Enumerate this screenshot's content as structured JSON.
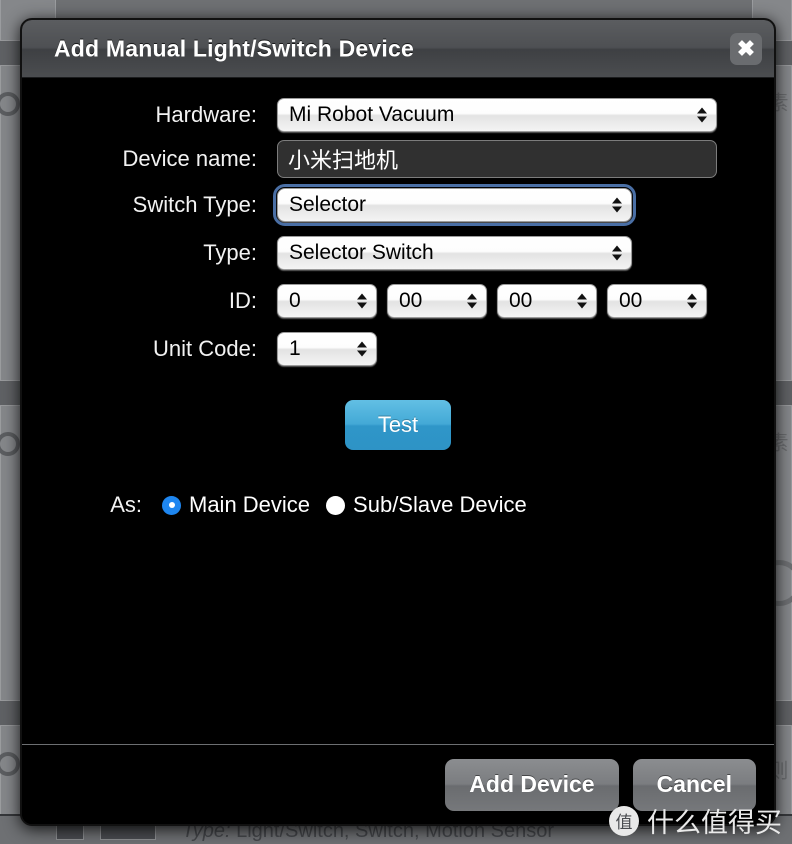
{
  "modal": {
    "title": "Add Manual Light/Switch Device",
    "close_label": "✖",
    "fields": {
      "hardware_label": "Hardware:",
      "hardware_value": "Mi Robot Vacuum",
      "device_name_label": "Device name:",
      "device_name_value": "小米扫地机",
      "device_name_placeholder": "",
      "switch_type_label": "Switch Type:",
      "switch_type_value": "Selector",
      "type_label": "Type:",
      "type_value": "Selector Switch",
      "id_label": "ID:",
      "id_values": [
        "0",
        "00",
        "00",
        "00"
      ],
      "unit_code_label": "Unit Code:",
      "unit_code_value": "1"
    },
    "test_button": "Test",
    "as_label": "As:",
    "radios": [
      {
        "label": "Main Device",
        "selected": true
      },
      {
        "label": "Sub/Slave Device",
        "selected": false
      }
    ],
    "footer": {
      "add_label": "Add Device",
      "cancel_label": "Cancel"
    },
    "colors": {
      "accent_blue": "#2f96c8",
      "radio_blue": "#1e86f0",
      "focus_ring": "#4a6fa5",
      "modal_bg": "#000000",
      "titlebar": "#4e5053"
    }
  },
  "background": {
    "bottom_text_italic": "Type:",
    "bottom_text": " Light/Switch, Switch, Motion Sensor"
  },
  "watermark": {
    "badge": "值",
    "text": "什么值得买"
  }
}
